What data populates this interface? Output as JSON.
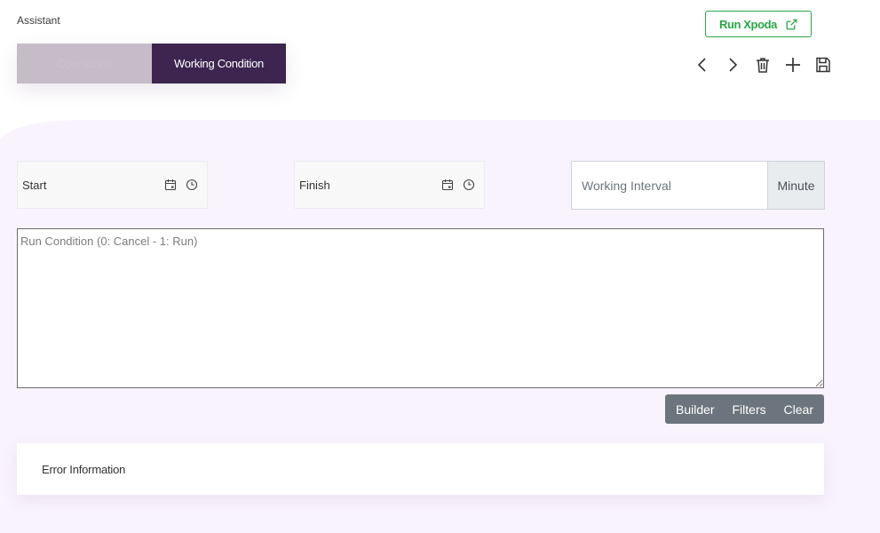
{
  "app": {
    "title": "Assistant"
  },
  "tabs": [
    {
      "label": "Operations",
      "active": false
    },
    {
      "label": "Working Condition",
      "active": true
    }
  ],
  "run_button": {
    "label": "Run Xpoda",
    "icon": "external-link-icon",
    "color": "#28a745"
  },
  "toolbar": {
    "icons": [
      "chevron-left-icon",
      "chevron-right-icon",
      "trash-icon",
      "plus-icon",
      "save-icon"
    ]
  },
  "fields": {
    "start": {
      "label": "Start",
      "icons": [
        "calendar-icon",
        "clock-icon"
      ]
    },
    "finish": {
      "label": "Finish",
      "icons": [
        "calendar-icon",
        "clock-icon"
      ]
    },
    "interval": {
      "placeholder": "Working Interval",
      "value": "",
      "unit": "Minute"
    }
  },
  "run_condition": {
    "placeholder": "Run Condition (0: Cancel - 1: Run)",
    "value": ""
  },
  "condition_actions": {
    "builder": "Builder",
    "filters": "Filters",
    "clear": "Clear"
  },
  "error_card": {
    "title": "Error Information"
  },
  "colors": {
    "accent": "#3e2550",
    "background": "#f9f3fd",
    "success": "#28a745",
    "secondary": "#6c757d"
  }
}
